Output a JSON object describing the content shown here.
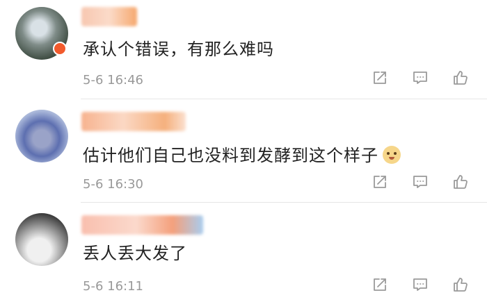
{
  "comments": [
    {
      "text": "承认个错误，有那么难吗",
      "time": "5-6 16:46",
      "has_badge": true
    },
    {
      "text": "估计他们自己也没料到发酵到这个样子",
      "time": "5-6 16:30",
      "emoji": "doge-emoji"
    },
    {
      "text": "丢人丢大发了",
      "time": "5-6 16:11"
    }
  ],
  "icons": {
    "share": "share-icon",
    "reply": "comment-icon",
    "like": "thumbs-up-icon"
  },
  "colors": {
    "text": "#222222",
    "timestamp": "#999999",
    "icon": "#9a9a9a",
    "divider": "#e6e6e6"
  }
}
